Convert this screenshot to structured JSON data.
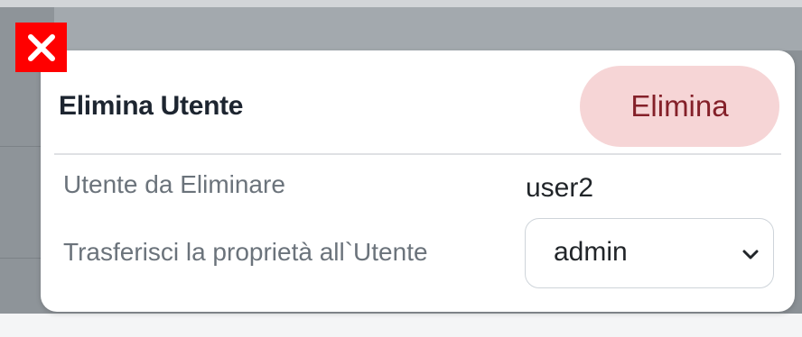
{
  "modal": {
    "title": "Elimina Utente",
    "delete_button_label": "Elimina",
    "close_icon": "close-icon",
    "fields": {
      "user_label": "Utente da Eliminare",
      "user_value": "user2",
      "transfer_label": "Trasferisci la proprietà all`Utente",
      "transfer_selected": "admin"
    }
  },
  "colors": {
    "close_box": "#ff0000",
    "danger_button_bg": "#f6d5d6",
    "danger_button_text": "#842029",
    "title_text": "#1d2530"
  }
}
